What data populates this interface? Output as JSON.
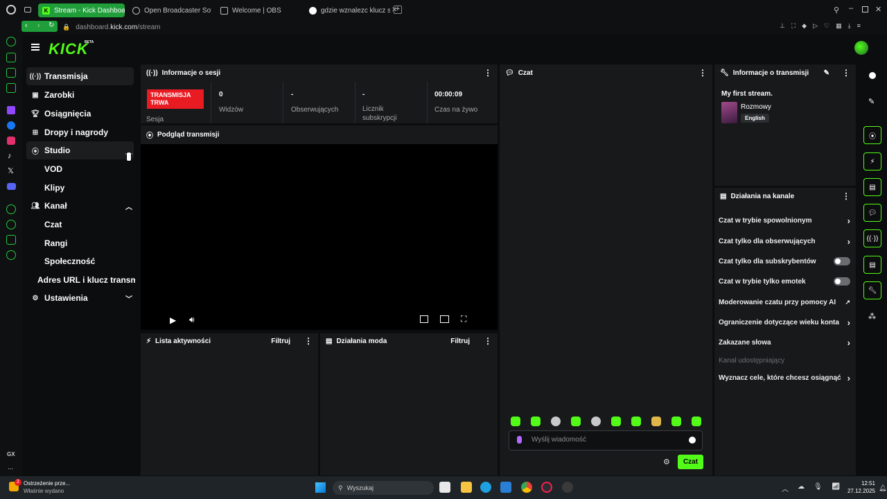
{
  "browser": {
    "tabs": [
      {
        "label": "Stream - Kick Dashboard",
        "active": true
      },
      {
        "label": "Open Broadcaster Softwa",
        "active": false
      },
      {
        "label": "Welcome | OBS",
        "active": false
      },
      {
        "label": "gdzie wznalezc klucz strea",
        "active": false
      }
    ],
    "url_host": "dashboard.",
    "url_domain": "kick.com",
    "url_path": "/stream"
  },
  "brand": {
    "logo": "KICK",
    "badge": "BETA",
    "accent": "#53fc18"
  },
  "nav": {
    "transmisja": "Transmisja",
    "zarobki": "Zarobki",
    "osiagniecia": "Osiągnięcia",
    "dropy": "Dropy i nagrody",
    "studio": "Studio",
    "vod": "VOD",
    "klipy": "Klipy",
    "kanal": "Kanał",
    "czat": "Czat",
    "rangi": "Rangi",
    "spolecznosc": "Społeczność",
    "adres": "Adres URL i klucz transmisji",
    "ustawienia": "Ustawienia"
  },
  "session": {
    "title": "Informacje o sesji",
    "badge": "TRANSMISJA TRWA",
    "badge_label": "Sesja",
    "stats": [
      {
        "value": "0",
        "label": "Widzów"
      },
      {
        "value": "-",
        "label": "Obserwujących"
      },
      {
        "value": "-",
        "label": "Licznik subskrypcji"
      },
      {
        "value": "00:00:09",
        "label": "Czas na żywo"
      }
    ]
  },
  "preview": {
    "title": "Podgląd transmisji"
  },
  "activity": {
    "title": "Lista aktywności",
    "filter": "Filtruj"
  },
  "modactions": {
    "title": "Działania moda",
    "filter": "Filtruj"
  },
  "chat": {
    "title": "Czat",
    "placeholder": "Wyślij wiadomość",
    "send": "Czat"
  },
  "stream_info": {
    "title": "Informacje o transmisji",
    "stream_title": "My first stream.",
    "category": "Rozmowy",
    "language": "English"
  },
  "channel_actions": {
    "title": "Działania na kanale",
    "items": [
      {
        "label": "Czat w trybie spowolnionym",
        "kind": "chevron"
      },
      {
        "label": "Czat tylko dla obserwujących",
        "kind": "chevron"
      },
      {
        "label": "Czat tylko dla subskrybentów",
        "kind": "toggle"
      },
      {
        "label": "Czat w trybie tylko emotek",
        "kind": "toggle"
      },
      {
        "label": "Moderowanie czatu przy pomocy AI",
        "kind": "external"
      },
      {
        "label": "Ograniczenie dotyczące wieku konta",
        "kind": "chevron"
      },
      {
        "label": "Zakazane słowa",
        "kind": "chevron"
      },
      {
        "label": "Kanał udostępniający",
        "kind": "disabled"
      },
      {
        "label": "Wyznacz cele, które chcesz osiągnąć",
        "kind": "chevron"
      }
    ]
  },
  "taskbar": {
    "notification_title": "Ostrzeżenie prze...",
    "notification_sub": "Właśnie wydano",
    "notification_count": "2",
    "search": "Wyszukaj",
    "time": "12:51",
    "date": "27.12.2025"
  },
  "opera_sidebar": {
    "gx_label": "GX",
    "more": "..."
  }
}
